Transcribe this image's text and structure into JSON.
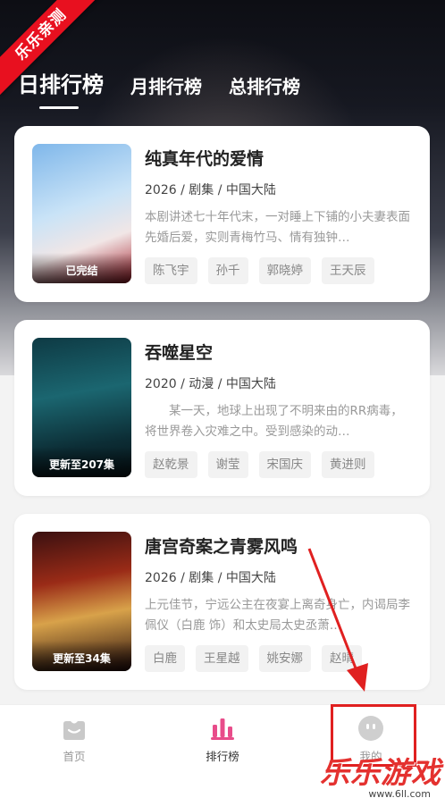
{
  "ribbon": "乐乐亲测",
  "tabs": [
    {
      "label": "日排行榜",
      "active": true
    },
    {
      "label": "月排行榜",
      "active": false
    },
    {
      "label": "总排行榜",
      "active": false
    }
  ],
  "items": [
    {
      "title": "纯真年代的爱情",
      "meta": "2026 / 剧集 / 中国大陆",
      "desc": "本剧讲述七十年代末，一对睡上下铺的小夫妻表面先婚后爱，实则青梅竹马、情有独钟…",
      "status": "已完结",
      "actors": [
        "陈飞宇",
        "孙千",
        "郭晓婷",
        "王天辰"
      ]
    },
    {
      "title": "吞噬星空",
      "meta": "2020 / 动漫 / 中国大陆",
      "desc": "　　某一天，地球上出现了不明来由的RR病毒，将世界卷入灾难之中。受到感染的动…",
      "status": "更新至207集",
      "actors": [
        "赵乾景",
        "谢莹",
        "宋国庆",
        "黄进则"
      ]
    },
    {
      "title": "唐宫奇案之青雾风鸣",
      "meta": "2026 / 剧集 / 中国大陆",
      "desc": "上元佳节，宁远公主在夜宴上离奇身亡，内谒局李佩仪（白鹿 饰）和太史局太史丞萧…",
      "status": "更新至34集",
      "actors": [
        "白鹿",
        "王星越",
        "姚安娜",
        "赵晴"
      ]
    }
  ],
  "nav": [
    {
      "label": "首页",
      "icon": "home-icon"
    },
    {
      "label": "排行榜",
      "icon": "ranking-icon"
    },
    {
      "label": "我的",
      "icon": "profile-icon"
    }
  ],
  "watermark": {
    "title": "乐乐游戏",
    "url": "www.6ll.com"
  },
  "colors": {
    "accent": "#e84c8a",
    "ribbon": "#e8101f",
    "highlight": "#e02020"
  }
}
